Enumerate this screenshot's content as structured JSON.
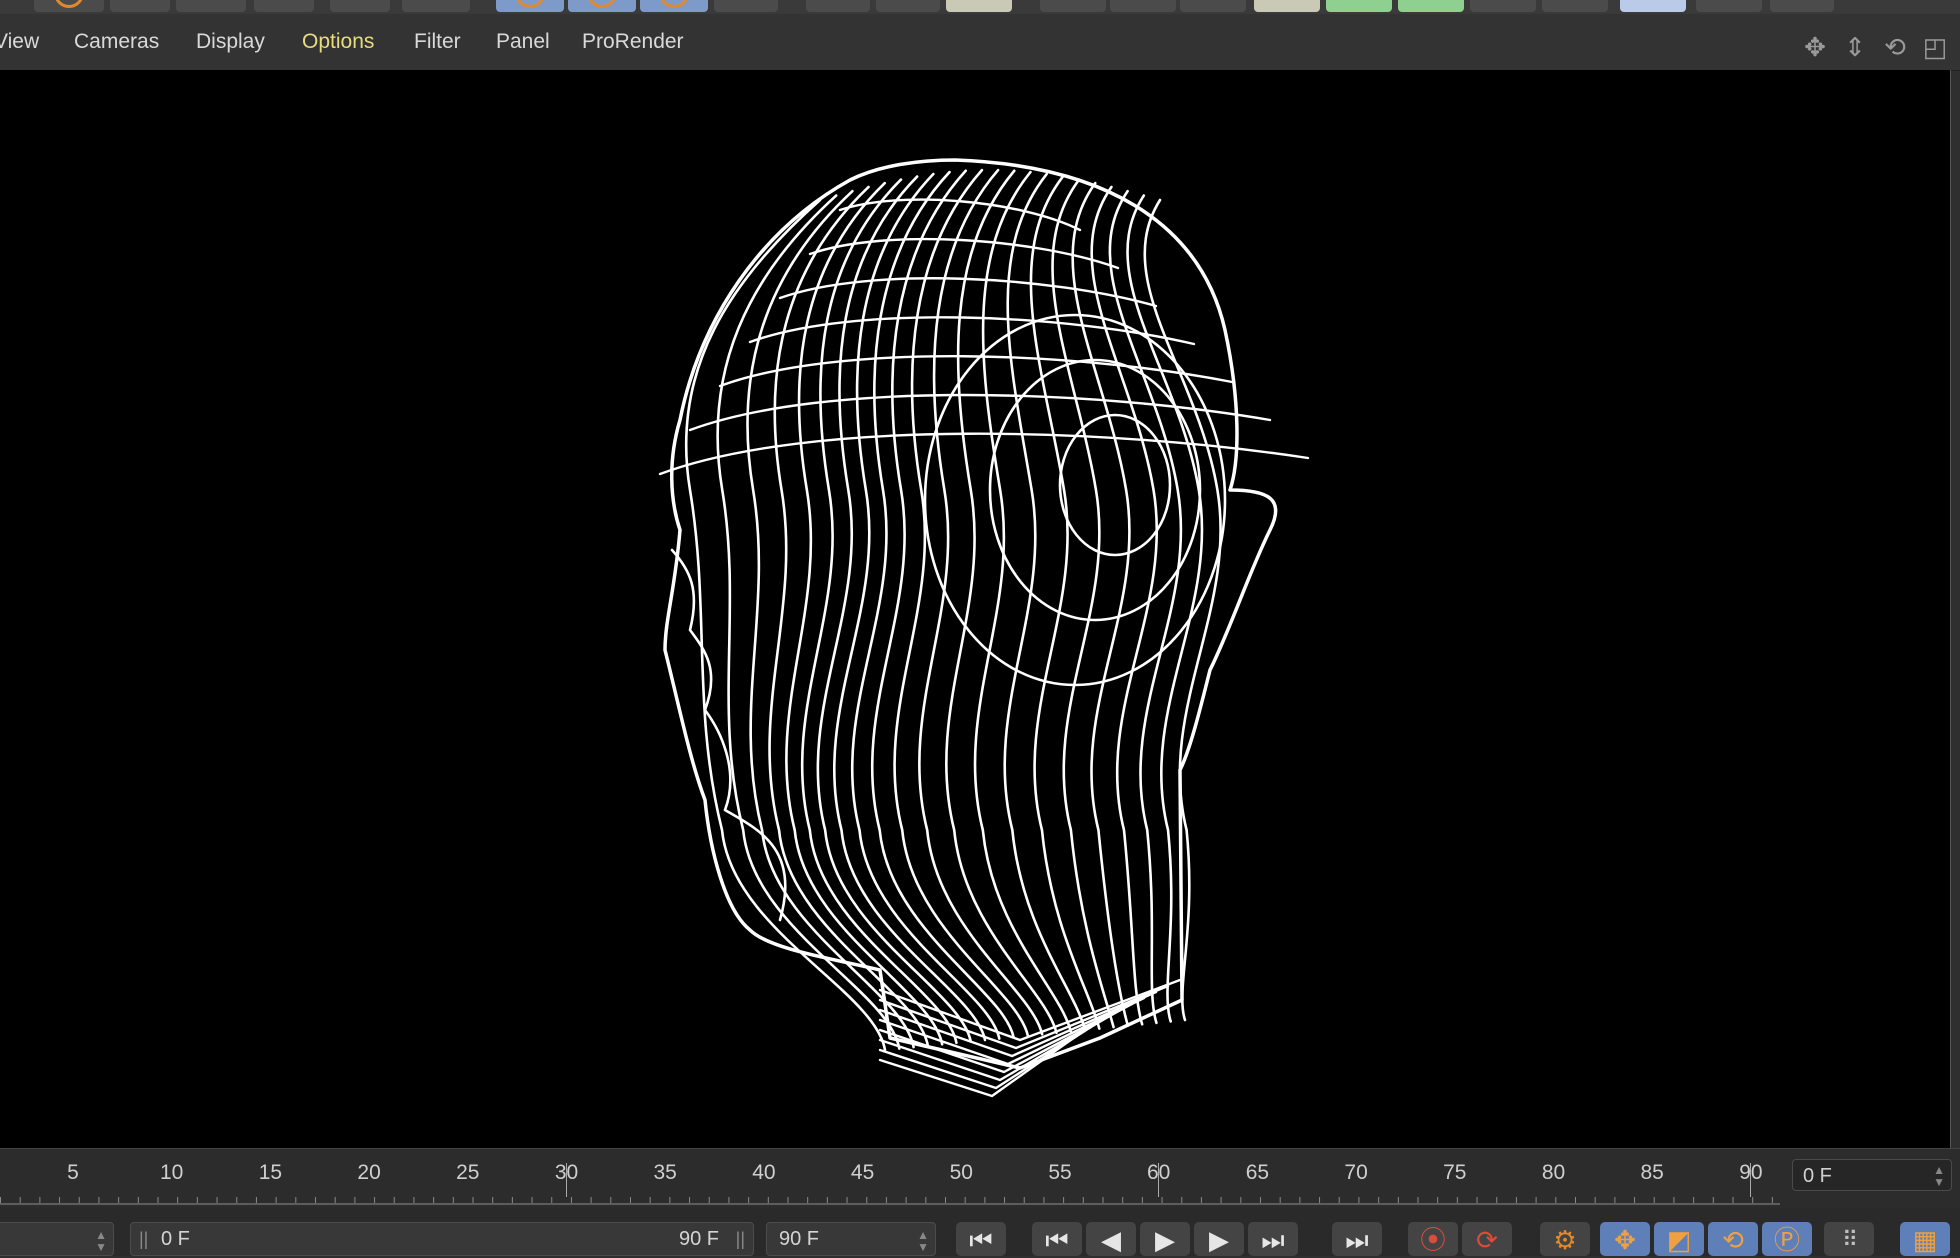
{
  "menu": {
    "items": [
      {
        "label": "View"
      },
      {
        "label": "Cameras"
      },
      {
        "label": "Display"
      },
      {
        "label": "Options"
      },
      {
        "label": "Filter"
      },
      {
        "label": "Panel"
      },
      {
        "label": "ProRender"
      }
    ],
    "active_index": 3,
    "active_color": "#e7dc7e"
  },
  "nav_icons": [
    "move-view-icon",
    "dolly-view-icon",
    "rotate-view-icon",
    "maximize-view-icon"
  ],
  "viewport": {
    "background": "#000000",
    "wire_color": "#ffffff",
    "object": "wireframe-head-model"
  },
  "timeline": {
    "ticks": [
      "5",
      "10",
      "15",
      "20",
      "25",
      "30",
      "35",
      "40",
      "45",
      "50",
      "55",
      "60",
      "65",
      "70",
      "75",
      "80",
      "85",
      "90"
    ],
    "current_frame": "0 F"
  },
  "transport": {
    "start_frame": "0 F",
    "range_end": "90 F",
    "end_frame": "90 F",
    "buttons": [
      "go-to-start-icon",
      "previous-keyframe-icon",
      "step-back-icon",
      "play-icon",
      "step-forward-icon",
      "next-keyframe-icon",
      "go-to-end-icon",
      "record-keys-icon",
      "autokey-icon",
      "keyframe-settings-icon",
      "position-key-icon",
      "scale-key-icon",
      "rotation-key-icon",
      "parameter-key-icon",
      "point-level-icon",
      "timeline-film-icon"
    ]
  }
}
